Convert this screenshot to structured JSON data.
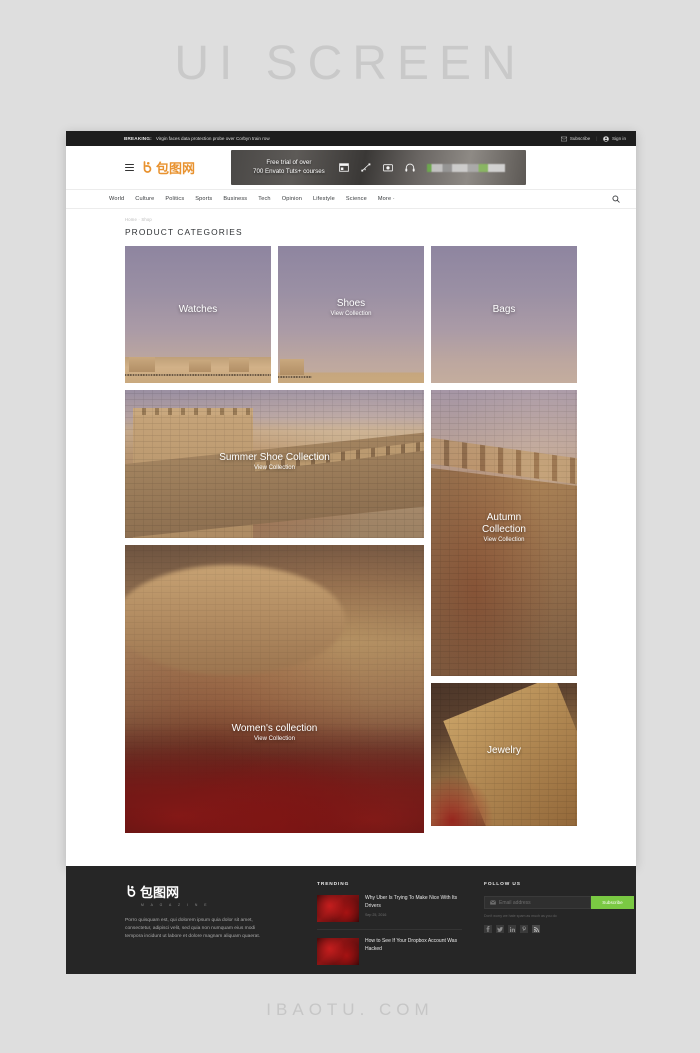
{
  "canvas": {
    "title": "UI SCREEN",
    "watermark": "IBAOTU. COM"
  },
  "breaking_bar": {
    "label": "BREAKING:",
    "text": "Virgin faces data protection probe over Corbyn train row",
    "subscribe_label": "Subscribe",
    "signin_label": "Sign in"
  },
  "header": {
    "logo_text": "包图网",
    "promo": {
      "line1": "Free trial of over",
      "line2": "700 Envato Tuts+ courses"
    }
  },
  "nav": {
    "items": [
      {
        "label": "World"
      },
      {
        "label": "Culture"
      },
      {
        "label": "Politics"
      },
      {
        "label": "Sports"
      },
      {
        "label": "Business"
      },
      {
        "label": "Tech"
      },
      {
        "label": "Opinion"
      },
      {
        "label": "Lifestyle"
      },
      {
        "label": "Science"
      },
      {
        "label": "More ·"
      }
    ]
  },
  "breadcrumb": {
    "home": "Home",
    "separator": "·",
    "current": "Shop"
  },
  "page_title": "PRODUCT CATEGORIES",
  "cards": {
    "watches": {
      "title": "Watches",
      "sub": ""
    },
    "shoes": {
      "title": "Shoes",
      "sub": "View Collection"
    },
    "bags": {
      "title": "Bags",
      "sub": ""
    },
    "summer": {
      "title": "Summer Shoe Collection",
      "sub": "View Collection"
    },
    "autumn": {
      "title": "Autumn",
      "title2": "Collection",
      "sub": "View Collection"
    },
    "women": {
      "title": "Women's collection",
      "sub": "View Collection"
    },
    "jewelry": {
      "title": "Jewelry",
      "sub": ""
    }
  },
  "footer": {
    "logo_text": "包图网",
    "logo_sub": "M A G A Z I N E",
    "description": "Porro quisquam est, qui dolorem ipsum quia dolor sit amet, consectetur, adipisci velit, sed quia non numquam eius modi tempora incidunt ut labore et dolore magnam aliquam quaerat.",
    "trending_heading": "TRENDING",
    "trending": [
      {
        "title": "Why Uber Is Trying To Make Nice With Its Drivers",
        "date": "Sep 25, 2016"
      },
      {
        "title": "How to See If Your Dropbox Account Was Hacked",
        "date": ""
      }
    ],
    "follow_heading": "FOLLOW US",
    "email_placeholder": "Email address",
    "subscribe_button": "Subscribe",
    "spam_note": "Don't worry we hate spam as much as you do",
    "socials": [
      "facebook-icon",
      "twitter-icon",
      "linkedin-icon",
      "pinterest-icon",
      "rss-icon"
    ]
  },
  "colors": {
    "accent_green": "#7ac943",
    "logo_orange": "#e8922f",
    "footer_bg": "#262626",
    "bar_bg": "#1d1d1d"
  }
}
